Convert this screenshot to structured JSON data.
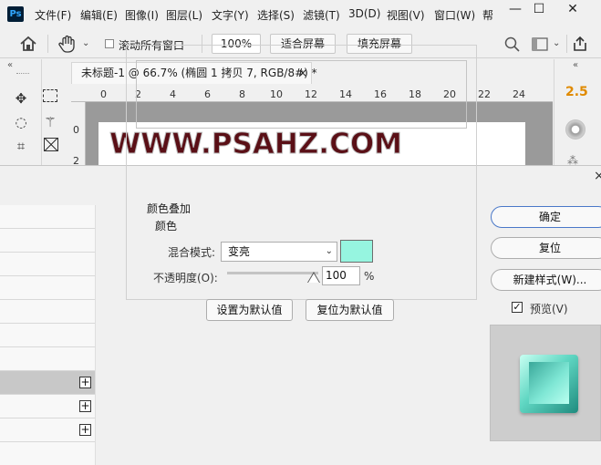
{
  "photoshop": {
    "logo": "Ps",
    "menu": [
      "文件(F)",
      "编辑(E)",
      "图像(I)",
      "图层(L)",
      "文字(Y)",
      "选择(S)",
      "滤镜(T)",
      "3D(D)",
      "视图(V)",
      "窗口(W)",
      "帮"
    ],
    "window_controls": {
      "minimize": "—",
      "maximize": "☐",
      "close": "✕"
    },
    "options_bar": {
      "home_icon": "home-icon",
      "hand_icon": "hand-icon",
      "scroll_all_label": "滚动所有窗口",
      "zoom_value": "100%",
      "fit_screen_label": "适合屏幕",
      "fill_screen_label": "填充屏幕"
    },
    "collapse_left": "«",
    "collapse_right": "«",
    "document": {
      "tab_title": "未标题-1 @ 66.7% (椭圆 1 拷贝 7, RGB/8#) *",
      "tab_close": "×",
      "ruler_numbers": [
        "0",
        "2",
        "4",
        "6",
        "8",
        "10",
        "12",
        "14",
        "16",
        "18",
        "20",
        "22",
        "24"
      ],
      "left_ruler_numbers": [
        "0",
        "2"
      ],
      "canvas_text": "WWW.PSAHZ.COM"
    },
    "right_panel_value": "2.5"
  },
  "dialog": {
    "close": "×",
    "section_title": "颜色叠加",
    "group_title": "颜色",
    "blend_mode_label": "混合模式:",
    "blend_mode_value": "变亮",
    "overlay_color": "#96f5e0",
    "opacity_label": "不透明度(O):",
    "opacity_value": "100",
    "opacity_unit": "%",
    "opacity_level": 1.0,
    "set_default_label": "设置为默认值",
    "reset_default_label": "复位为默认值",
    "ok_label": "确定",
    "reset_label": "复位",
    "new_style_label": "新建样式(W)...",
    "preview_label": "预览(V)",
    "preview_checked": true,
    "style_row_plus": "+"
  }
}
